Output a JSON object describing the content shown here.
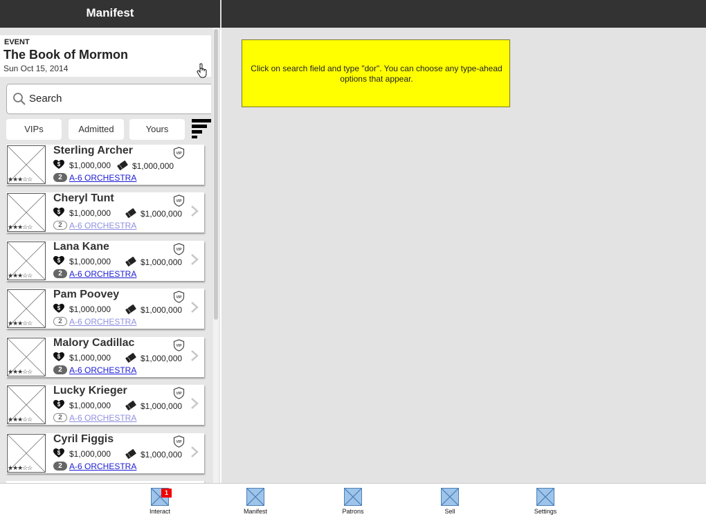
{
  "header": {
    "title": "Manifest"
  },
  "event": {
    "label": "EVENT",
    "name": "The Book of Mormon",
    "date": "Sun Oct 15, 2014"
  },
  "search": {
    "placeholder": "Search"
  },
  "filters": [
    "VIPs",
    "Admitted",
    "Yours"
  ],
  "patrons": [
    {
      "name": "Sterling Archer",
      "spend": "$1,000,000",
      "ticket_value": "$1,000,000",
      "count": "2",
      "seat": "A-6 ORCHESTRA",
      "rating": 3,
      "admitted": true
    },
    {
      "name": "Cheryl Tunt",
      "spend": "$1,000,000",
      "ticket_value": "$1,000,000",
      "count": "2",
      "seat": "A-6 ORCHESTRA",
      "rating": 3,
      "admitted": false
    },
    {
      "name": "Lana Kane",
      "spend": "$1,000,000",
      "ticket_value": "$1,000,000",
      "count": "2",
      "seat": "A-6 ORCHESTRA",
      "rating": 3,
      "admitted": true
    },
    {
      "name": "Pam Poovey",
      "spend": "$1,000,000",
      "ticket_value": "$1,000,000",
      "count": "2",
      "seat": "A-6 ORCHESTRA",
      "rating": 3,
      "admitted": false
    },
    {
      "name": "Malory Cadillac",
      "spend": "$1,000,000",
      "ticket_value": "$1,000,000",
      "count": "2",
      "seat": "A-6 ORCHESTRA",
      "rating": 3,
      "admitted": true
    },
    {
      "name": "Lucky Krieger",
      "spend": "$1,000,000",
      "ticket_value": "$1,000,000",
      "count": "2",
      "seat": "A-6 ORCHESTRA",
      "rating": 3,
      "admitted": false
    },
    {
      "name": "Cyril Figgis",
      "spend": "$1,000,000",
      "ticket_value": "$1,000,000",
      "count": "2",
      "seat": "A-6 ORCHESTRA",
      "rating": 3,
      "admitted": true
    }
  ],
  "note": {
    "text": "Click on search field and type \"dor\". You can choose any type-ahead options that appear."
  },
  "tabs": [
    {
      "label": "Interact",
      "badge": "1"
    },
    {
      "label": "Manifest"
    },
    {
      "label": "Patrons"
    },
    {
      "label": "Sell"
    },
    {
      "label": "Settings"
    }
  ],
  "colors": {
    "header_bg": "#333333",
    "note_bg": "#ffff00",
    "link": "#1a1ad6",
    "badge": "#ee0000"
  }
}
